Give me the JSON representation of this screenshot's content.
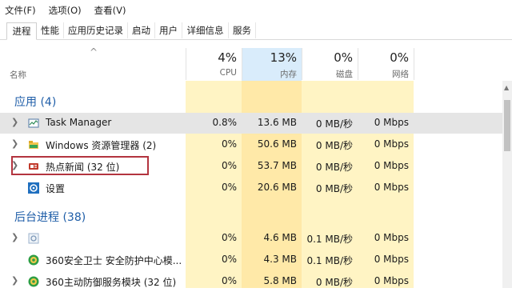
{
  "menu": [
    "文件(F)",
    "选项(O)",
    "查看(V)"
  ],
  "tabs": [
    {
      "label": "进程",
      "active": true
    },
    {
      "label": "性能"
    },
    {
      "label": "应用历史记录"
    },
    {
      "label": "启动"
    },
    {
      "label": "用户"
    },
    {
      "label": "详细信息"
    },
    {
      "label": "服务"
    }
  ],
  "header": {
    "name_label": "名称",
    "sort_arrow": "^",
    "cpu": {
      "pct": "4%",
      "label": "CPU"
    },
    "mem": {
      "pct": "13%",
      "label": "内存"
    },
    "disk": {
      "pct": "0%",
      "label": "磁盘"
    },
    "net": {
      "pct": "0%",
      "label": "网络"
    }
  },
  "groups": {
    "apps": "应用 (4)",
    "background": "后台进程 (38)"
  },
  "apps": [
    {
      "name": "Task Manager",
      "cpu": "0.8%",
      "mem": "13.6 MB",
      "disk": "0 MB/秒",
      "net": "0 Mbps",
      "icon": "task-manager-icon",
      "expandable": true,
      "highlighted": true
    },
    {
      "name": "Windows 资源管理器 (2)",
      "cpu": "0%",
      "mem": "50.6 MB",
      "disk": "0 MB/秒",
      "net": "0 Mbps",
      "icon": "explorer-icon",
      "expandable": true
    },
    {
      "name": "热点新闻 (32 位)",
      "cpu": "0%",
      "mem": "53.7 MB",
      "disk": "0 MB/秒",
      "net": "0 Mbps",
      "icon": "news-icon",
      "expandable": true,
      "boxed": true
    },
    {
      "name": "设置",
      "cpu": "0%",
      "mem": "20.6 MB",
      "disk": "0 MB/秒",
      "net": "0 Mbps",
      "icon": "settings-gear-icon",
      "expandable": false
    }
  ],
  "background": [
    {
      "name": "",
      "cpu": "0%",
      "mem": "4.6 MB",
      "disk": "0.1 MB/秒",
      "net": "0 Mbps",
      "icon": "generic-process-icon",
      "expandable": true
    },
    {
      "name": "360安全卫士 安全防护中心模...",
      "cpu": "0%",
      "mem": "4.3 MB",
      "disk": "0.1 MB/秒",
      "net": "0 Mbps",
      "icon": "360-icon",
      "expandable": false
    },
    {
      "name": "360主动防御服务模块 (32 位)",
      "cpu": "0%",
      "mem": "5.8 MB",
      "disk": "0 MB/秒",
      "net": "0 Mbps",
      "icon": "360-icon",
      "expandable": true
    }
  ],
  "colors": {
    "group_text": "#1f5ea8",
    "column_tint": "#fff4c4",
    "mem_column_tint": "#ffe9a8",
    "mem_header": "#d9ecfb",
    "highlight_row": "#e5e5e5",
    "red_box": "#b3343f"
  }
}
